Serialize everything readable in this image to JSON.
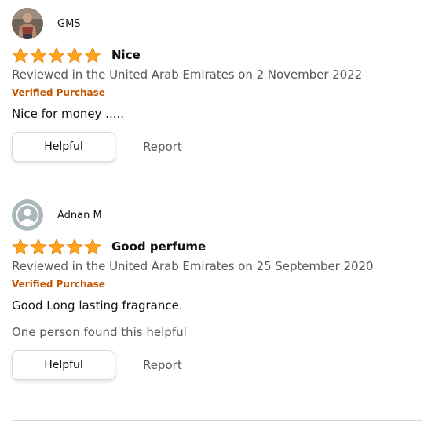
{
  "colors": {
    "star": "#ffa41c",
    "verified": "#c45500",
    "secondary_text": "#565959",
    "primary_text": "#0f1111"
  },
  "reviews": [
    {
      "profile_name": "GMS",
      "avatar_icon": "user-photo-icon",
      "rating": 5,
      "title": "Nice",
      "date_text": "Reviewed in the United Arab Emirates on 2 November 2022",
      "verified_label": "Verified Purchase",
      "body": "Nice for money .....",
      "helpful_count_text": "",
      "helpful_label": "Helpful",
      "report_label": "Report"
    },
    {
      "profile_name": "Adnan M",
      "avatar_icon": "default-user-icon",
      "rating": 5,
      "title": "Good perfume",
      "date_text": "Reviewed in the United Arab Emirates on 25 September 2020",
      "verified_label": "Verified Purchase",
      "body": "Good Long lasting fragrance.",
      "helpful_count_text": "One person found this helpful",
      "helpful_label": "Helpful",
      "report_label": "Report"
    }
  ]
}
